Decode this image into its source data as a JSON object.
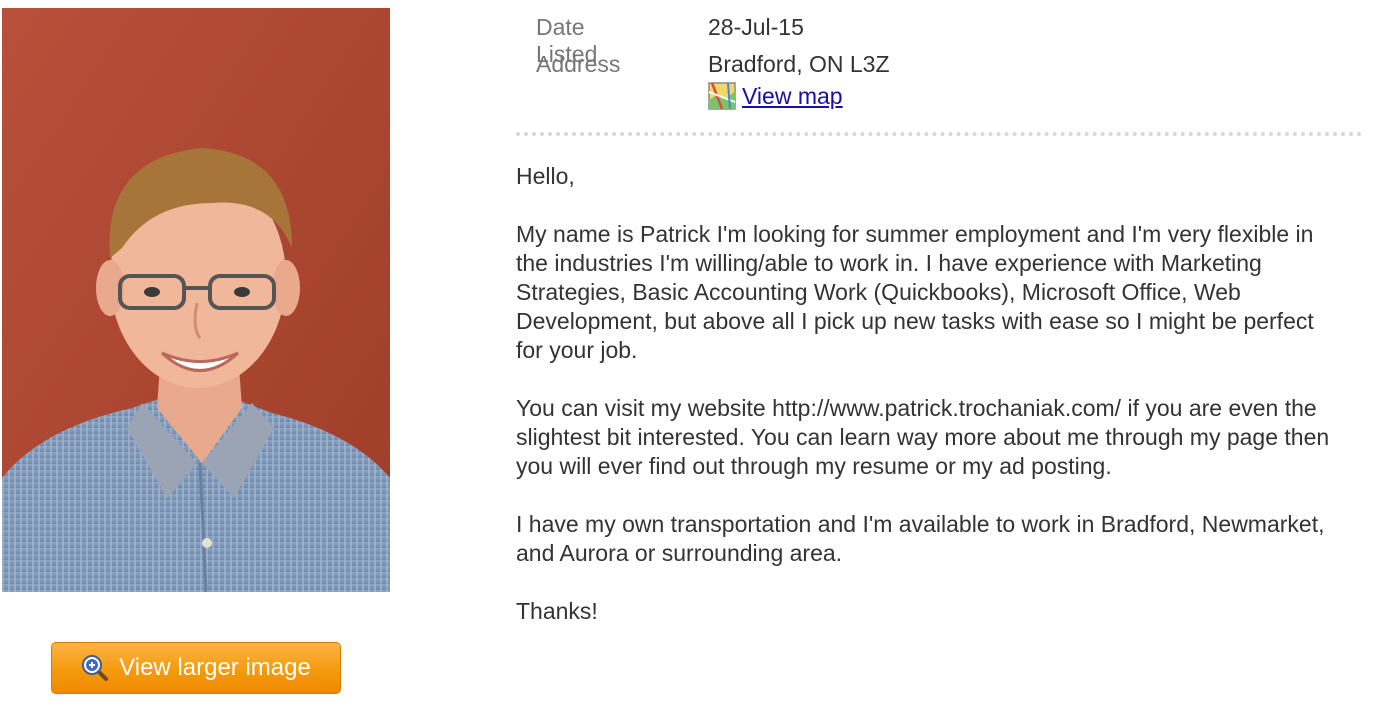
{
  "listing": {
    "date_listed_label": "Date Listed",
    "date_listed_value": "28-Jul-15",
    "address_label": "Address",
    "address_value": "Bradford, ON L3Z",
    "view_map_label": "View map"
  },
  "photo": {
    "view_larger_label": "View larger image"
  },
  "description": {
    "greeting": "Hello,",
    "paragraph_1": "My name is Patrick I'm looking for summer employment and I'm very flexible in the industries I'm willing/able to work in. I have experience with Marketing Strategies, Basic Accounting Work (Quickbooks), Microsoft Office, Web Development, but above all I pick up new tasks with ease so I might be perfect for your job.",
    "paragraph_2": "You can visit my website http://www.patrick.trochaniak.com/ if you are even the slightest bit interested. You can learn way more about me through my page then you will ever find out through my resume or my ad posting.",
    "paragraph_3": "I have my own transportation and I'm available to work in Bradford, Newmarket, and Aurora or surrounding area.",
    "closing": "Thanks!"
  },
  "icons": {
    "zoom": "zoom-in-icon",
    "map": "map-icon"
  },
  "colors": {
    "button_orange": "#f59a0c",
    "link_blue": "#1a0dab",
    "photo_background": "#b24a32"
  }
}
